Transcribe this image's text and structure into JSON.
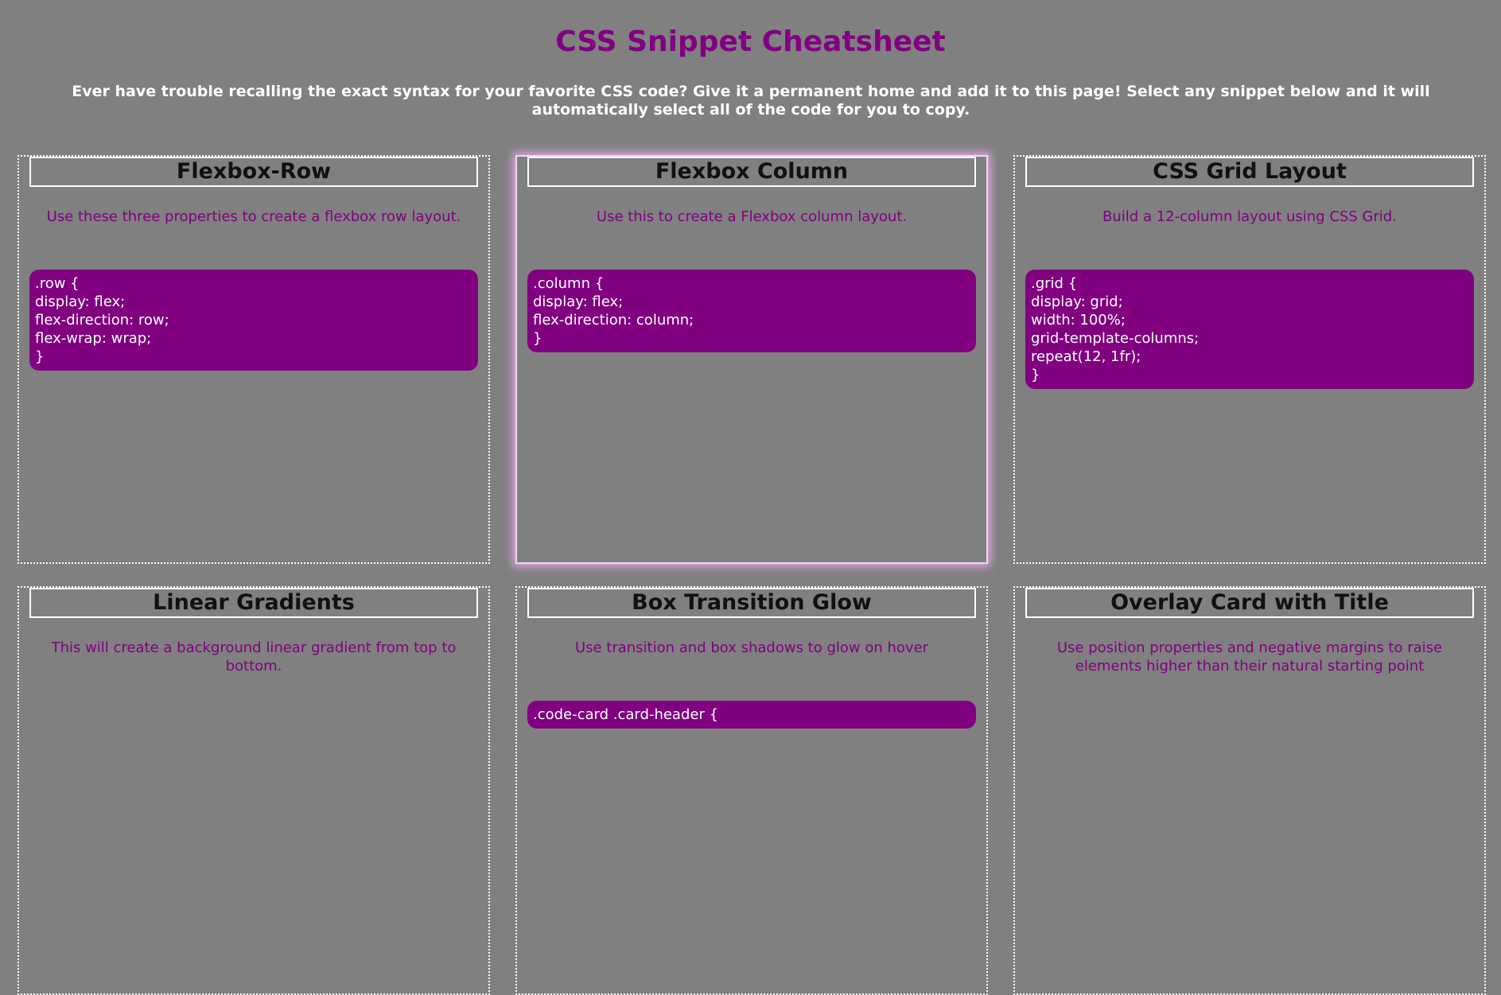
{
  "header": {
    "title": "CSS Snippet Cheatsheet",
    "intro": "Ever have trouble recalling the exact syntax for your favorite CSS code? Give it a permanent home and add it to this page! Select any snippet below and it will automatically select all of the code for you to copy."
  },
  "cards": [
    {
      "title": "Flexbox-Row",
      "description": "Use these three properties to create a flexbox row layout.",
      "code": ".row {\ndisplay: flex;\nflex-direction: row;\nflex-wrap: wrap;\n}"
    },
    {
      "title": "Flexbox Column",
      "description": "Use this to create a Flexbox column layout.",
      "code": ".column {\ndisplay: flex;\nflex-direction: column;\n}"
    },
    {
      "title": "CSS Grid Layout",
      "description": "Build a 12-column layout using CSS Grid.",
      "code": ".grid {\ndisplay: grid;\nwidth: 100%;\ngrid-template-columns;\nrepeat(12, 1fr);\n}"
    },
    {
      "title": "Linear Gradients",
      "description": "This will create a background linear gradient from top to bottom."
    },
    {
      "title": "Box Transition Glow",
      "description": "Use transition and box shadows to glow on hover",
      "code": ".code-card .card-header {"
    },
    {
      "title": "Overlay Card with Title",
      "description": "Use position properties and negative margins to raise elements higher than their natural starting point"
    }
  ],
  "colors": {
    "background": "#808080",
    "accent": "#800080",
    "text_light": "#ffffff",
    "glow": "#e6a6e6"
  }
}
